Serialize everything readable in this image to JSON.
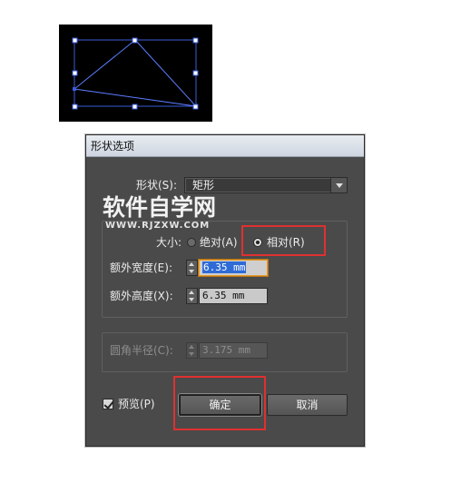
{
  "dialog": {
    "title": "形状选项",
    "shape_label": "形状(S):",
    "shape_value": "矩形",
    "size_label": "大小:",
    "size_options": [
      {
        "label": "绝对(A)",
        "checked": false
      },
      {
        "label": "相对(R)",
        "checked": true
      }
    ],
    "extra_width_label": "额外宽度(E):",
    "extra_width_value": "6.35 mm",
    "extra_height_label": "额外高度(X):",
    "extra_height_value": "6.35 mm",
    "corner_radius_label": "圆角半径(C):",
    "corner_radius_value": "3.175 mm",
    "preview_label": "预览(P)",
    "preview_checked": true,
    "ok_label": "确定",
    "cancel_label": "取消"
  },
  "watermark": {
    "main": "软件自学网",
    "sub": "WWW.RJZXW.COM"
  },
  "colors": {
    "dialog_bg": "#4a4a4a",
    "artboard_bg": "#000000",
    "selection_blue": "#3a5bd9",
    "annotation_red": "#e03030",
    "focus_orange": "#e49a2a"
  }
}
